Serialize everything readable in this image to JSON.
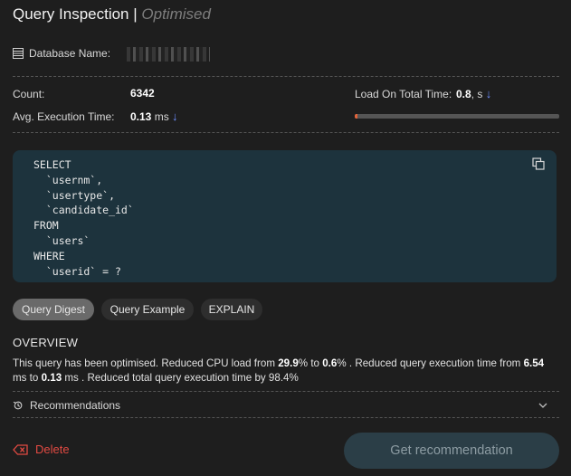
{
  "header": {
    "title": "Query Inspection |",
    "status": "Optimised"
  },
  "database": {
    "label": "Database Name:"
  },
  "metrics": {
    "count_label": "Count:",
    "count_value": "6342",
    "avg_exec_label": "Avg. Execution Time:",
    "avg_exec_value": "0.13",
    "avg_exec_unit": "ms",
    "load_label": "Load On Total Time:",
    "load_value": "0.8",
    "load_unit": ", s",
    "load_bar_fraction": 0.01,
    "arrow_icon": "arrow-down-icon"
  },
  "query": {
    "sql": "SELECT\n  `usernm`,\n  `usertype`,\n  `candidate_id`\nFROM\n  `users`\nWHERE\n  `userid` = ?",
    "copy_icon": "copy-icon"
  },
  "tabs": [
    {
      "label": "Query Digest",
      "active": true
    },
    {
      "label": "Query Example",
      "active": false
    },
    {
      "label": "EXPLAIN",
      "active": false
    }
  ],
  "overview": {
    "heading": "OVERVIEW",
    "t1": "This query has been optimised. Reduced CPU load from ",
    "cpu_from": "29.9",
    "t2": "% to ",
    "cpu_to": "0.6",
    "t3": "% .  Reduced query execution time from ",
    "exec_from": "6.54",
    "t4": " ms to ",
    "exec_to": "0.13",
    "t5": " ms . Reduced total query execution time by 98.4%"
  },
  "recommendations": {
    "label": "Recommendations"
  },
  "actions": {
    "delete_label": "Delete",
    "get_rec_label": "Get recommendation"
  },
  "colors": {
    "accent_blue": "#6f8fff",
    "danger": "#e24a42",
    "code_bg": "#1d333d",
    "bar_fill": "#e2633a"
  }
}
